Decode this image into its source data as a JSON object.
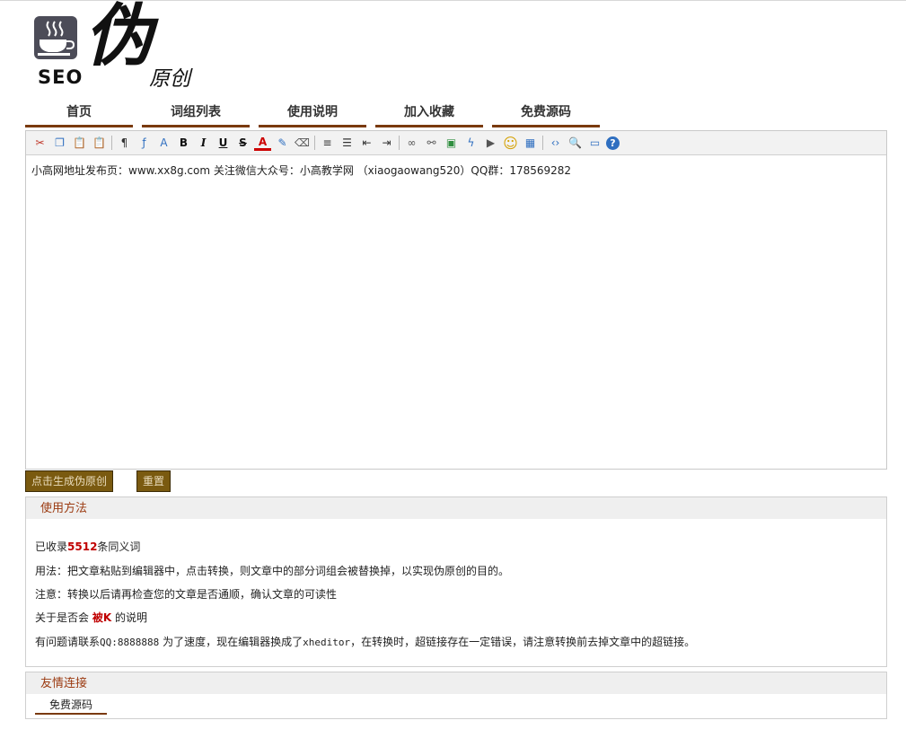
{
  "logo": {
    "seo": "SEO",
    "wei": "伪",
    "yuanchuang": "原创"
  },
  "nav": [
    "首页",
    "词组列表",
    "使用说明",
    "加入收藏",
    "免费源码"
  ],
  "editor": {
    "content": "小高网地址发布页：www.xx8g.com 关注微信大众号：小高教学网 （xiaogaowang520）QQ群：178569282",
    "toolbar": [
      {
        "icon": "cut-icon",
        "glyph": "✂",
        "color": "#c0392b"
      },
      {
        "icon": "copy-icon",
        "glyph": "❐",
        "color": "#2f6fc0"
      },
      {
        "icon": "paste-icon",
        "glyph": "📋",
        "color": "#8a5a12"
      },
      {
        "icon": "paste-text-icon",
        "glyph": "📋",
        "color": "#8a5a12"
      },
      {
        "sep": true
      },
      {
        "icon": "block-format-icon",
        "glyph": "¶",
        "color": "#333"
      },
      {
        "icon": "font-family-icon",
        "glyph": "ƒ",
        "color": "#2f6fc0"
      },
      {
        "icon": "font-size-icon",
        "glyph": "A",
        "color": "#2f6fc0"
      },
      {
        "icon": "bold-icon",
        "glyph": "B",
        "color": "#111"
      },
      {
        "icon": "italic-icon",
        "glyph": "I",
        "color": "#111"
      },
      {
        "icon": "underline-icon",
        "glyph": "U",
        "color": "#111"
      },
      {
        "icon": "strikethrough-icon",
        "glyph": "S",
        "color": "#111"
      },
      {
        "icon": "font-color-icon",
        "glyph": "A",
        "color": "#c00"
      },
      {
        "icon": "background-color-icon",
        "glyph": "✎",
        "color": "#2f6fc0"
      },
      {
        "icon": "remove-format-icon",
        "glyph": "⌫",
        "color": "#555"
      },
      {
        "sep": true
      },
      {
        "icon": "align-icon",
        "glyph": "≡",
        "color": "#333"
      },
      {
        "icon": "list-icon",
        "glyph": "☰",
        "color": "#333"
      },
      {
        "icon": "outdent-icon",
        "glyph": "⇤",
        "color": "#333"
      },
      {
        "icon": "indent-icon",
        "glyph": "⇥",
        "color": "#333"
      },
      {
        "sep": true
      },
      {
        "icon": "link-icon",
        "glyph": "∞",
        "color": "#555"
      },
      {
        "icon": "unlink-icon",
        "glyph": "⚯",
        "color": "#555"
      },
      {
        "icon": "image-icon",
        "glyph": "▣",
        "color": "#2f8f3f"
      },
      {
        "icon": "flash-icon",
        "glyph": "ϟ",
        "color": "#2f6fc0"
      },
      {
        "icon": "media-icon",
        "glyph": "▶",
        "color": "#555"
      },
      {
        "icon": "emoticon-icon",
        "glyph": "☺",
        "color": "#d4a000"
      },
      {
        "icon": "table-icon",
        "glyph": "▦",
        "color": "#2f6fc0"
      },
      {
        "sep": true
      },
      {
        "icon": "source-code-icon",
        "glyph": "‹›",
        "color": "#2f6fc0"
      },
      {
        "icon": "preview-icon",
        "glyph": "🔍",
        "color": "#555"
      },
      {
        "icon": "fullscreen-icon",
        "glyph": "▭",
        "color": "#2f6fc0"
      },
      {
        "icon": "help-icon",
        "glyph": "?",
        "color": "#fff"
      }
    ]
  },
  "buttons": {
    "generate": "点击生成伪原创",
    "reset": "重置"
  },
  "usage": {
    "title": "使用方法",
    "line1_pre": "已收录",
    "line1_count": "5512",
    "line1_post": "条同义词",
    "line2": "用法：把文章粘贴到编辑器中，点击转换，则文章中的部分词组会被替换掉，以实现伪原创的目的。",
    "line3": "注意：转换以后请再检查您的文章是否通顺，确认文章的可读性",
    "line4_pre": "关于是否会 ",
    "line4_red": "被K",
    "line4_post": " 的说明",
    "line5_pre": "有问题请联系",
    "line5_qq": "QQ:8888888",
    "line5_mid": " 为了速度，现在编辑器换成了",
    "line5_x": "xheditor",
    "line5_post": "，在转换时，超链接存在一定错误，请注意转换前去掉文章中的超链接。"
  },
  "links": {
    "title": "友情连接",
    "item": "免费源码"
  }
}
